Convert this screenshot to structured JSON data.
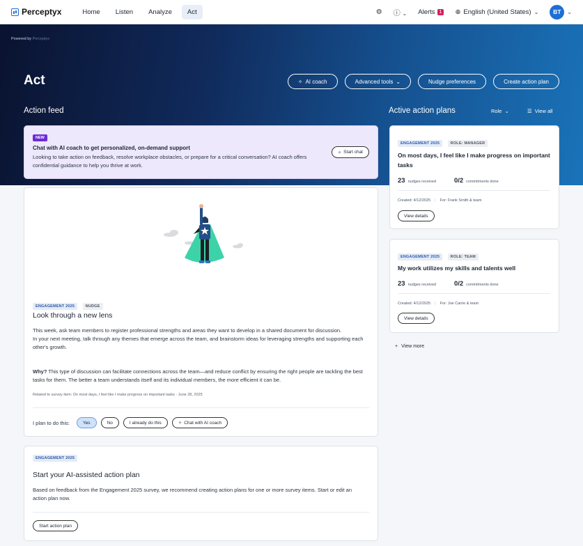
{
  "nav": {
    "brand": "Perceptyx",
    "tabs": [
      "Home",
      "Listen",
      "Analyze",
      "Act"
    ],
    "alerts_label": "Alerts",
    "alerts_count": "1",
    "language": "English (United States)",
    "avatar_initials": "BT"
  },
  "hero": {
    "powered_by": "Powered by",
    "powered_brand": "Perceptyx",
    "title": "Act",
    "buttons": {
      "ai_coach": "AI coach",
      "advanced_tools": "Advanced tools",
      "nudge_preferences": "Nudge preferences",
      "create_action_plan": "Create action plan"
    },
    "action_feed": "Action feed",
    "active_plans": "Active action plans",
    "role": "Role",
    "view_all": "View all"
  },
  "promo": {
    "badge": "NEW",
    "title": "Chat with AI coach to get personalized, on-demand support",
    "body": "Looking to take action on feedback, resolve workplace obstacles, or prepare for a critical conversation? AI coach offers confidential guidance to help you thrive at work.",
    "button": "Start chat"
  },
  "nudge": {
    "chips": [
      "ENGAGEMENT 2025",
      "NUDGE"
    ],
    "title": "Look through a new lens",
    "para1": "This week, ask team members to register professional strengths and areas they want to develop in a shared document for discussion.",
    "para2": "In your next meeting, talk through any themes that emerge across the team, and brainstorm ideas for leveraging strengths and supporting each other's growth.",
    "why_label": "Why?",
    "why_text": "This type of discussion can facilitate connections across the team—and reduce conflict by ensuring the right people are tackling the best tasks for them. The better a team understands itself and its individual members, the more efficient it can be.",
    "related": "Related to survey item: On most days, I feel like I make progress on important tasks",
    "related_date": "June 28, 2025",
    "plan_label": "I plan to do this:",
    "buttons": [
      "Yes",
      "No",
      "I already do this",
      "Chat with AI coach"
    ]
  },
  "ai_plan": {
    "chip": "ENGAGEMENT 2025",
    "title": "Start your AI-assisted action plan",
    "body": "Based on feedback from the Engagement 2025 survey, we recommend creating action plans for one or more survey items. Start or edit an action plan now.",
    "button": "Start action plan"
  },
  "plans": [
    {
      "chips": [
        "ENGAGEMENT 2025",
        "ROLE: MANAGER"
      ],
      "title": "On most days, I feel like I make progress on important tasks",
      "nudges": "23",
      "nudges_label": "nudges received",
      "commitments": "0/2",
      "commitments_label": "commitments done",
      "created": "Created: 4/12/2025",
      "for": "For: Frank Smith & team",
      "button": "View details"
    },
    {
      "chips": [
        "ENGAGEMENT 2025",
        "ROLE: TEAM"
      ],
      "title": "My work utilizes my skills and talents well",
      "nudges": "23",
      "nudges_label": "nudges received",
      "commitments": "0/2",
      "commitments_label": "commitments done",
      "created": "Created: 4/12/2025",
      "for": "For: Joe Carrie & team",
      "button": "View details"
    }
  ],
  "view_more": "View more",
  "colors": {
    "primary": "#1d6fd6",
    "alert_badge": "#d6215b",
    "new_badge": "#6c2bd9",
    "promo_bg": "#ede8fb"
  }
}
